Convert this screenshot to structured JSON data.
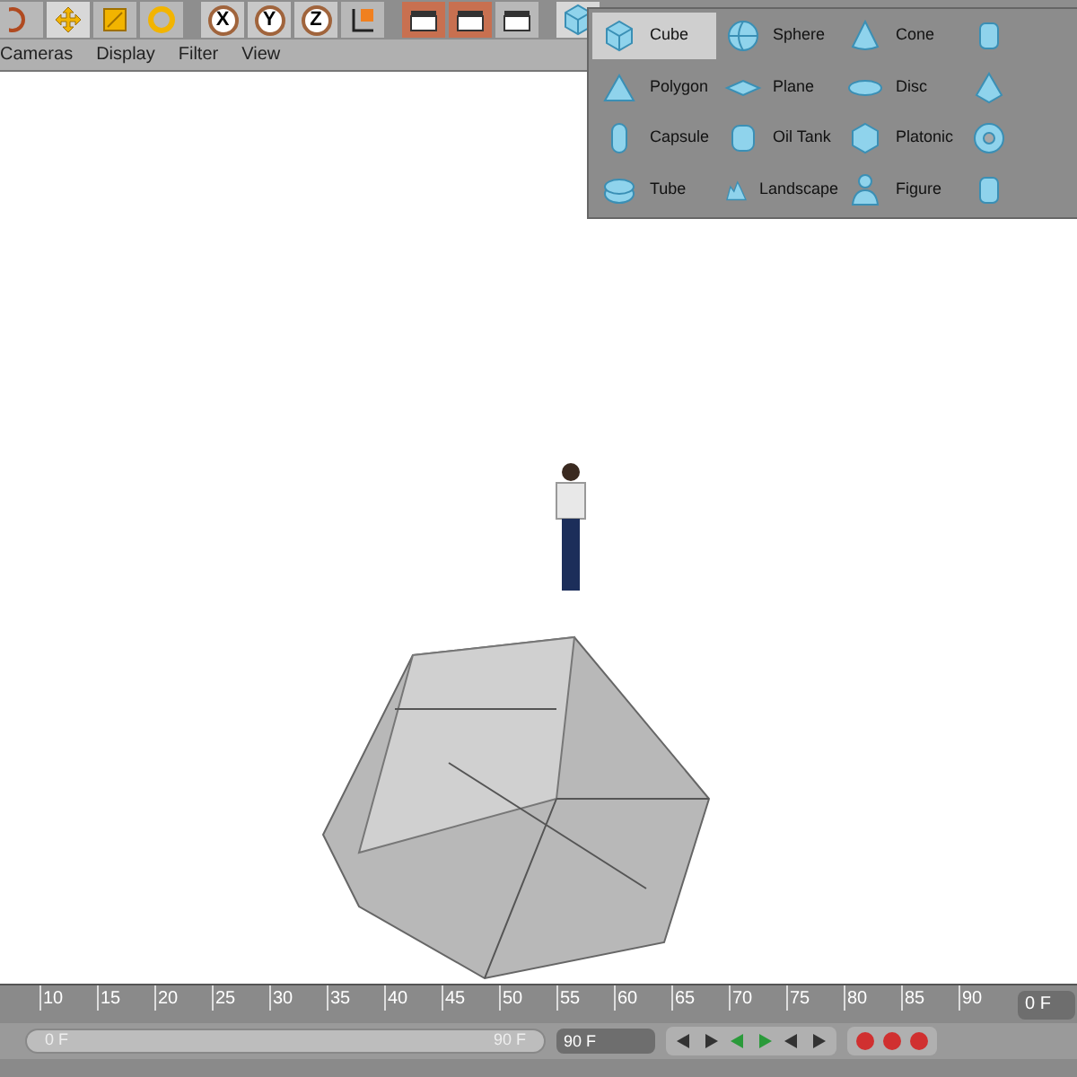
{
  "toolbar": {
    "axis_buttons": [
      "X",
      "Y",
      "Z"
    ]
  },
  "menu_bar": [
    "Cameras",
    "Display",
    "Filter",
    "View"
  ],
  "object_menu": {
    "items": [
      {
        "label": "Cube",
        "kind": "cube",
        "selected": true
      },
      {
        "label": "Sphere",
        "kind": "sphere",
        "selected": false
      },
      {
        "label": "Cone",
        "kind": "cone",
        "selected": false
      },
      {
        "kind": "cylinder",
        "selected": false
      },
      {
        "label": "Polygon",
        "kind": "polygon",
        "selected": false
      },
      {
        "label": "Plane",
        "kind": "plane",
        "selected": false
      },
      {
        "label": "Disc",
        "kind": "disc",
        "selected": false
      },
      {
        "kind": "pyramid",
        "selected": false
      },
      {
        "label": "Capsule",
        "kind": "capsule",
        "selected": false
      },
      {
        "label": "Oil Tank",
        "kind": "oiltank",
        "selected": false
      },
      {
        "label": "Platonic",
        "kind": "platonic",
        "selected": false
      },
      {
        "kind": "torus",
        "selected": false
      },
      {
        "label": "Tube",
        "kind": "tube",
        "selected": false
      },
      {
        "label": "Landscape",
        "kind": "landscape",
        "selected": false
      },
      {
        "label": "Figure",
        "kind": "figure",
        "selected": false
      },
      {
        "kind": "cylinder",
        "selected": false
      }
    ]
  },
  "timeline": {
    "ticks": [
      "10",
      "15",
      "20",
      "25",
      "30",
      "35",
      "40",
      "45",
      "50",
      "55",
      "60",
      "65",
      "70",
      "75",
      "80",
      "85",
      "90"
    ],
    "current_frame": "0 F"
  },
  "transport": {
    "level": 1,
    "range_start": "0 F",
    "range_end": "90 F",
    "end_frame": "90 F"
  }
}
